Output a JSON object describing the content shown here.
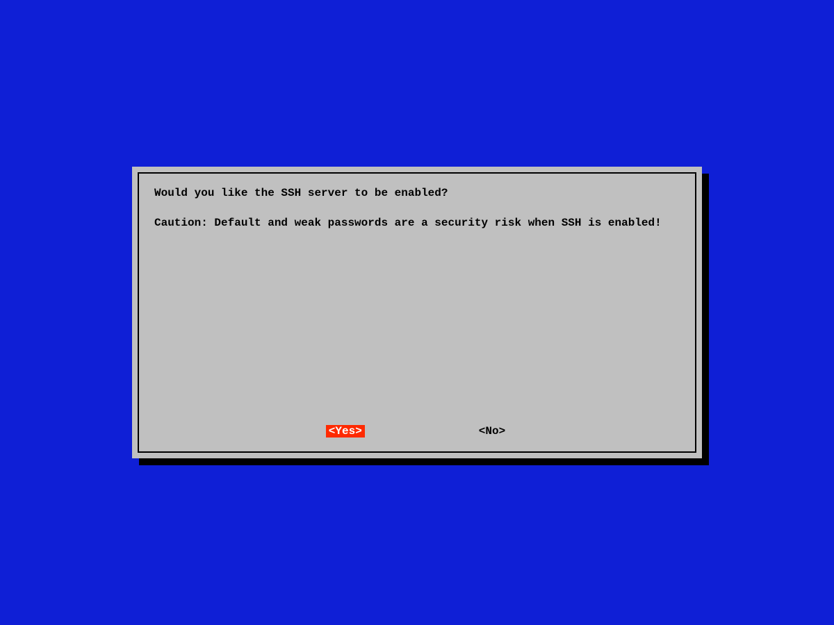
{
  "dialog": {
    "question": "Would you like the SSH server to be enabled?",
    "caution": "Caution: Default and weak passwords are a security risk when SSH is enabled!",
    "buttons": {
      "yes": "<Yes>",
      "no": "<No>"
    },
    "selected": "yes"
  },
  "colors": {
    "background": "#0f1fd6",
    "panel": "#c0c0c0",
    "highlight": "#ff2a00"
  }
}
